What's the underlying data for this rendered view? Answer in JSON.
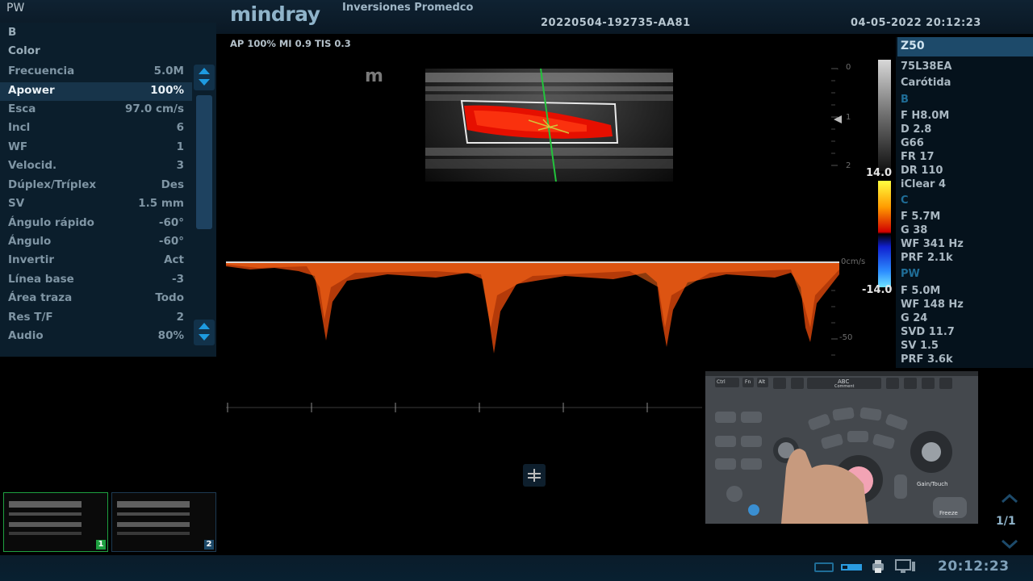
{
  "header": {
    "mode": "PW",
    "brand": "mindray",
    "institution": "Inversiones Promedco",
    "patient_id": "20220504-192735-AA81",
    "datetime": "04-05-2022  20:12:23",
    "acoustic": "AP 100%   MI 0.9  TIS 0.3"
  },
  "left_menu": {
    "headers": [
      "B",
      "Color"
    ],
    "rows": [
      {
        "label": "Frecuencia",
        "value": "5.0M"
      },
      {
        "label": "Apower",
        "value": "100%"
      },
      {
        "label": "Esca",
        "value": "97.0 cm/s"
      },
      {
        "label": "Incl",
        "value": "6"
      },
      {
        "label": "WF",
        "value": "1"
      },
      {
        "label": "Velocid.",
        "value": "3"
      },
      {
        "label": "Dúplex/Tríplex",
        "value": "Des"
      },
      {
        "label": "SV",
        "value": "1.5 mm"
      },
      {
        "label": "Ángulo rápido",
        "value": "-60°"
      },
      {
        "label": "Ángulo",
        "value": "-60°"
      },
      {
        "label": "Invertir",
        "value": "Act"
      },
      {
        "label": "Línea base",
        "value": "-3"
      },
      {
        "label": "Área traza",
        "value": "Todo"
      },
      {
        "label": "Res T/F",
        "value": "2"
      },
      {
        "label": "Audio",
        "value": "80%"
      }
    ]
  },
  "image": {
    "probe_icon_text": "m",
    "depth_marks": [
      "0",
      "1",
      "2"
    ],
    "velocity_marks": [
      "0cm/s",
      "-50"
    ]
  },
  "scale": {
    "max": "14.0",
    "min": "-14.0"
  },
  "right_panel": {
    "title": "Z50",
    "probe": "75L38EA",
    "exam": "Carótida",
    "b_section": "B",
    "b_params": [
      "F H8.0M",
      "D 2.8",
      "G66",
      "FR 17",
      "DR 110",
      "iClear 4"
    ],
    "c_section": "C",
    "c_params": [
      "F 5.7M",
      "G 38",
      "WF 341 Hz",
      "PRF 2.1k"
    ],
    "pw_section": "PW",
    "pw_params": [
      "F 5.0M",
      "WF 148 Hz",
      "G 24",
      "SVD 11.7",
      "SV 1.5",
      "PRF 3.6k"
    ]
  },
  "thumbnails": [
    {
      "badge": "1"
    },
    {
      "badge": "2"
    }
  ],
  "console": {
    "abc_label": "ABC",
    "comment_label": "Comment",
    "gain_label": "Gain/Touch",
    "freeze_label": "Freeze",
    "key_ctrl": "Ctrl",
    "key_fn": "Fn",
    "key_alt": "Alt"
  },
  "footer": {
    "page": "1/1",
    "clock": "20:12:23"
  },
  "colors": {
    "panel_bg": "#0b1e2c",
    "active_row": "#17344a",
    "section_blue": "#1f6d97",
    "doppler_orange": "#ff5a10"
  }
}
